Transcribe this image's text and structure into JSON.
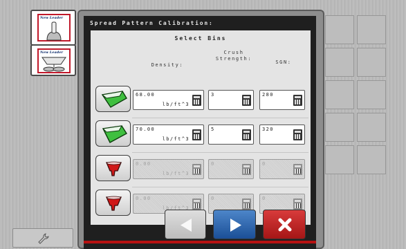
{
  "toolbox": {
    "tool1_logo": "New Leader",
    "tool2_logo": "New Leader"
  },
  "screen": {
    "title": "Spread Pattern Calibration:"
  },
  "panel": {
    "title": "Select Bins",
    "columns": {
      "density": "Density:",
      "crush_line1": "Crush",
      "crush_line2": "Strength:",
      "sgn": "SGN:"
    },
    "rows": [
      {
        "bin": "bin-1",
        "enabled": true,
        "density": "68.00",
        "density_unit": "lb/ft^3",
        "crush": "3",
        "sgn": "280"
      },
      {
        "bin": "bin-2",
        "enabled": true,
        "density": "70.00",
        "density_unit": "lb/ft^3",
        "crush": "5",
        "sgn": "320"
      },
      {
        "bin": "bin-3",
        "enabled": false,
        "density": "0.00",
        "density_unit": "lb/ft^3",
        "crush": "0",
        "sgn": "0"
      },
      {
        "bin": "bin-4",
        "enabled": false,
        "density": "0.00",
        "density_unit": "lb/ft^3",
        "crush": "0",
        "sgn": "0"
      }
    ]
  },
  "icons": {
    "prev": "left-arrow-icon",
    "next": "right-arrow-icon",
    "cancel": "close-icon",
    "settings": "wrench-icon"
  },
  "colors": {
    "bin_enabled": "#3fbf3f",
    "bin_disabled": "#d01818",
    "next_button": "#2a62ad",
    "cancel_button": "#c02626",
    "accent_line": "#b71212"
  }
}
